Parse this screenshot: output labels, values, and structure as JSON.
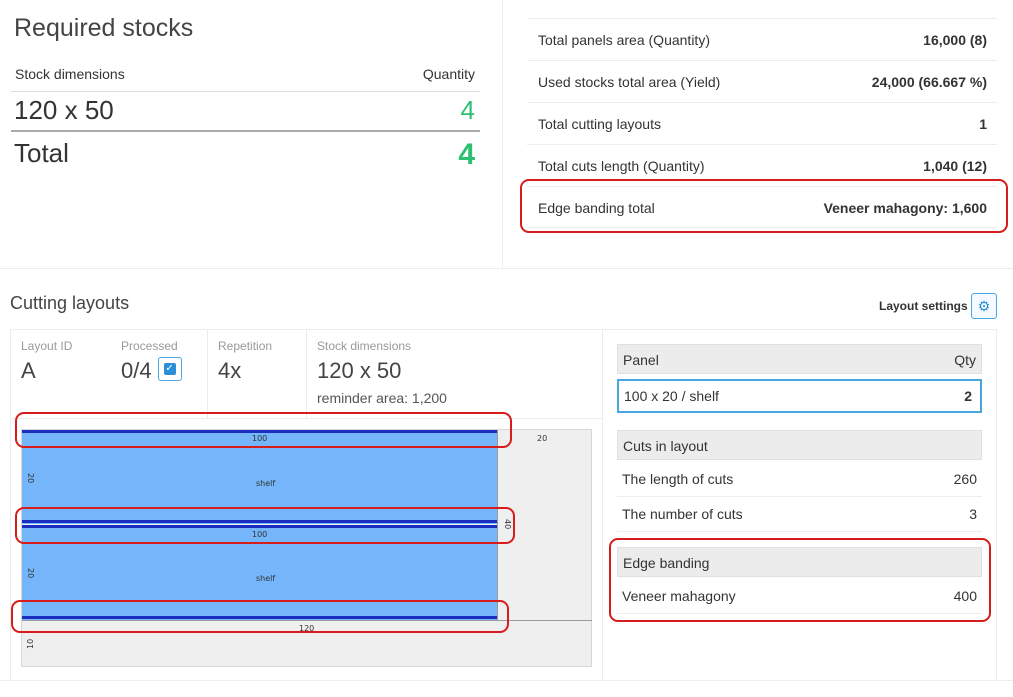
{
  "required_stocks": {
    "title": "Required stocks",
    "col_dimensions": "Stock dimensions",
    "col_quantity": "Quantity",
    "row_dimension": "120 x 50",
    "row_quantity": "4",
    "total_label": "Total",
    "total_value": "4"
  },
  "summary": {
    "rows": [
      {
        "label": "Total panels area (Quantity)",
        "value": "16,000 (8)"
      },
      {
        "label": "Used stocks total area (Yield)",
        "value": "24,000 (66.667 %)"
      },
      {
        "label": "Total cutting layouts",
        "value": "1"
      },
      {
        "label": "Total cuts length (Quantity)",
        "value": "1,040 (12)"
      },
      {
        "label": "Edge banding total",
        "value": "Veneer mahagony:  1,600"
      }
    ]
  },
  "cutting_layouts": {
    "title": "Cutting layouts",
    "settings_label": "Layout settings",
    "settings_icon": "gears-icon",
    "layout_id_label": "Layout ID",
    "layout_id": "A",
    "processed_label": "Processed",
    "processed": "0/4",
    "repetition_label": "Repetition",
    "repetition": "4x",
    "stock_dim_label": "Stock dimensions",
    "stock_dim": "120 x 50",
    "reminder": "reminder area: 1,200"
  },
  "diagram": {
    "panel_top_width": "100",
    "panel_bottom_width": "100",
    "panel_height_1": "20",
    "panel_height_2": "20",
    "panel_name_1": "shelf",
    "panel_name_2": "shelf",
    "waste_right_width": "20",
    "waste_right_height": "40",
    "stock_width": "120",
    "waste_bottom_height": "10",
    "panel_color": "#74b6f9",
    "edge_color": "#1a2fbf",
    "highlight_color": "#d81c1c"
  },
  "panel_table": {
    "col_panel": "Panel",
    "col_qty": "Qty",
    "row_panel": "100 x 20 / shelf",
    "row_qty": "2"
  },
  "cuts_table": {
    "header": "Cuts in layout",
    "rows": [
      {
        "label": "The length of cuts",
        "value": "260"
      },
      {
        "label": "The number of cuts",
        "value": "3"
      }
    ]
  },
  "edge_table": {
    "header": "Edge banding",
    "rows": [
      {
        "label": "Veneer mahagony",
        "value": "400"
      }
    ]
  }
}
